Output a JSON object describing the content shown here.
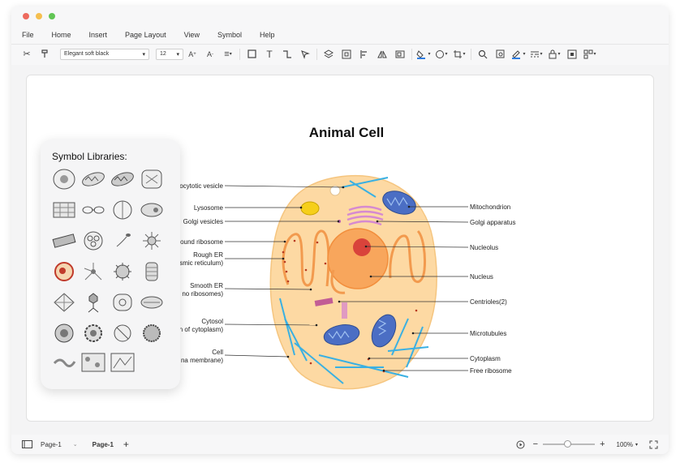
{
  "window": {
    "controls": [
      "#ed6a5e",
      "#f5bf4f",
      "#61c554"
    ]
  },
  "menu": {
    "items": [
      "File",
      "Home",
      "Insert",
      "Page Layout",
      "View",
      "Symbol",
      "Help"
    ]
  },
  "toolbar": {
    "font_name": "Elegant soft black",
    "font_size": "12"
  },
  "diagram": {
    "title": "Animal Cell",
    "labels_left": [
      "ocytotic vesicle",
      "Lysosome",
      "Golgi vesicles",
      "ound ribosome",
      "Rough ER",
      "smic reticulum)",
      "Smooth ER",
      "no ribosomes)",
      "Cytosol",
      "n of cytoplasm)",
      "Cell",
      "na membrane)"
    ],
    "labels_right": [
      "Mitochondrion",
      "Golgi apparatus",
      "Nucleolus",
      "Nucleus",
      "Centrioles(2)",
      "Microtubules",
      "Cytoplasm",
      "Free ribosome"
    ]
  },
  "symbol_panel": {
    "title": "Symbol Libraries:"
  },
  "status": {
    "page_selector": "Page-1",
    "active_page": "Page-1",
    "zoom": "100%"
  }
}
